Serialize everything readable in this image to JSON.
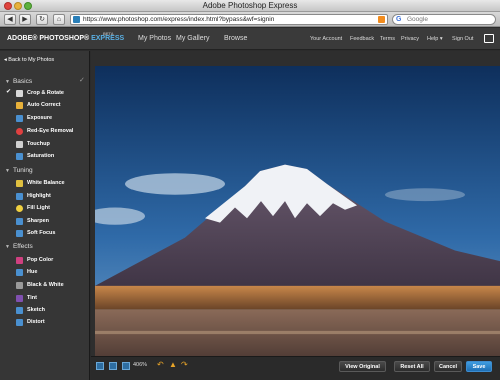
{
  "browser": {
    "window_title": "Adobe Photoshop Express",
    "nav": {
      "back": "◀",
      "forward": "▶",
      "reload": "↻",
      "home": "⌂"
    },
    "url": "https://www.photoshop.com/express/index.html?bypass&wf=signin",
    "search_placeholder": "Google"
  },
  "header": {
    "brand_main": "ADOBE® PHOTOSHOP®",
    "brand_express": "EXPRESS",
    "brand_beta": "BETA",
    "main_nav": [
      "My Photos",
      "My Gallery",
      "Browse"
    ],
    "right_nav": [
      "Your Account",
      "Feedback",
      "Terms",
      "Privacy",
      "Help ▾",
      "Sign Out"
    ]
  },
  "sidebar": {
    "back_label": "◂ Back to My Photos",
    "sections": [
      {
        "title": "Basics",
        "items": [
          {
            "label": "Crop & Rotate",
            "icon": "crop-icon",
            "color": "#d8d8d8"
          },
          {
            "label": "Auto Correct",
            "icon": "auto-correct-icon",
            "color": "#e8b13a"
          },
          {
            "label": "Exposure",
            "icon": "exposure-icon",
            "color": "#4a90d0"
          },
          {
            "label": "Red-Eye Removal",
            "icon": "red-eye-icon",
            "color": "#e04040"
          },
          {
            "label": "Touchup",
            "icon": "touchup-icon",
            "color": "#d0d0d0"
          },
          {
            "label": "Saturation",
            "icon": "saturation-icon",
            "color": "#4a90d0"
          }
        ]
      },
      {
        "title": "Tuning",
        "items": [
          {
            "label": "White Balance",
            "icon": "white-balance-icon",
            "color": "#e0c040"
          },
          {
            "label": "Highlight",
            "icon": "highlight-icon",
            "color": "#4a90d0"
          },
          {
            "label": "Fill Light",
            "icon": "fill-light-icon",
            "color": "#f0d040"
          },
          {
            "label": "Sharpen",
            "icon": "sharpen-icon",
            "color": "#4a90d0"
          },
          {
            "label": "Soft Focus",
            "icon": "soft-focus-icon",
            "color": "#4a90d0"
          }
        ]
      },
      {
        "title": "Effects",
        "items": [
          {
            "label": "Pop Color",
            "icon": "pop-color-icon",
            "color": "#d04080"
          },
          {
            "label": "Hue",
            "icon": "hue-icon",
            "color": "#4a90d0"
          },
          {
            "label": "Black & White",
            "icon": "black-white-icon",
            "color": "#9a9a9a"
          },
          {
            "label": "Tint",
            "icon": "tint-icon",
            "color": "#8050b0"
          },
          {
            "label": "Sketch",
            "icon": "sketch-icon",
            "color": "#4a90d0"
          },
          {
            "label": "Distort",
            "icon": "distort-icon",
            "color": "#4a90d0"
          }
        ]
      }
    ]
  },
  "bottombar": {
    "zoom": "406%",
    "buttons": {
      "view_original": "View Original",
      "reset_all": "Reset All",
      "cancel": "Cancel",
      "save": "Save"
    }
  },
  "colors": {
    "accent": "#5ab0e4",
    "save": "#2a80c8"
  }
}
